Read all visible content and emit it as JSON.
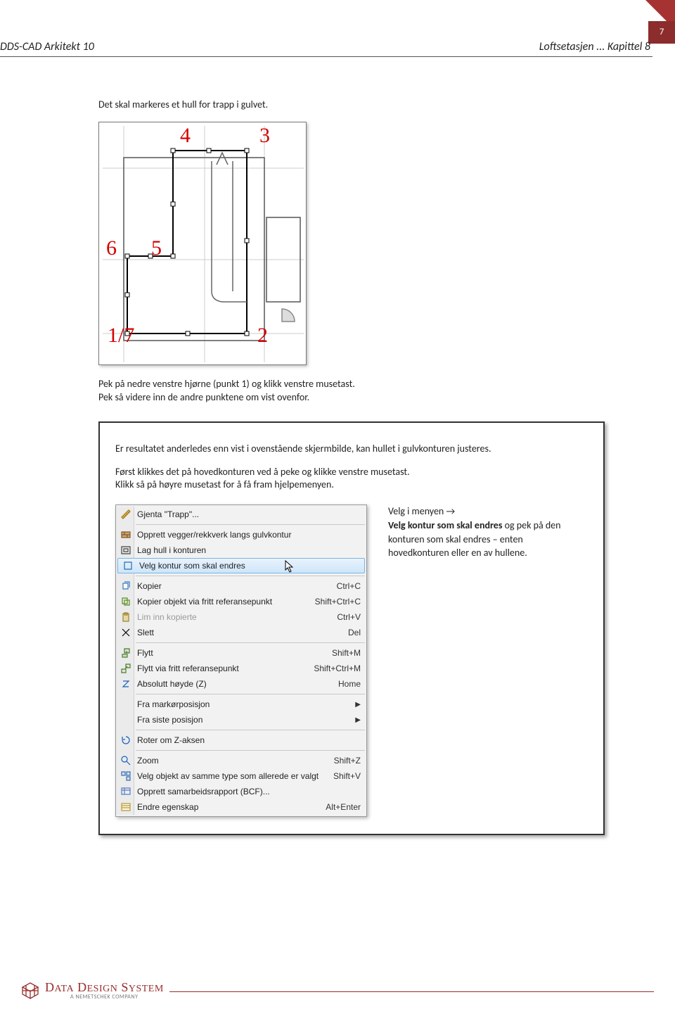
{
  "page": {
    "number": "7"
  },
  "header": {
    "left": "DDS-CAD Arkitekt 10",
    "right": "Loftsetasjen ... Kapittel 8"
  },
  "intro": "Det skal markeres et hull for trapp i gulvet.",
  "drawing": {
    "labels": {
      "n3": "3",
      "n4": "4",
      "n5": "5",
      "n6": "6",
      "n2": "2",
      "n17": "1/7"
    }
  },
  "after1": "Pek på nedre venstre hjørne (punkt 1) og klikk venstre musetast.",
  "after2": "Pek så videre inn de andre punktene om vist ovenfor.",
  "box": {
    "p1": "Er resultatet anderledes enn vist i ovenstående skjermbilde, kan hullet i gulvkonturen justeres.",
    "p2": "Først klikkes det på hovedkonturen ved å peke og klikke venstre musetast.",
    "p3": "Klikk så på høyre musetast for å få fram hjelpemenyen.",
    "side": {
      "lead": "Velg i menyen →",
      "bold": "Velg kontur som skal endres",
      "rest": "og pek på den konturen som skal endres – enten hovedkonturen eller en av hullene."
    }
  },
  "menu": {
    "items": [
      {
        "label": "Gjenta \"Trapp\"...",
        "shortcut": "",
        "icon": "ruler"
      },
      {
        "label": "Opprett vegger/rekkverk langs gulvkontur",
        "shortcut": "",
        "icon": "wall"
      },
      {
        "label": "Lag hull i konturen",
        "shortcut": "",
        "icon": "hole"
      },
      {
        "label": "Velg kontur som skal endres",
        "shortcut": "",
        "icon": "contour",
        "selected": true
      },
      {
        "label": "Kopier",
        "shortcut": "Ctrl+C",
        "icon": "copy"
      },
      {
        "label": "Kopier objekt via fritt referansepunkt",
        "shortcut": "Shift+Ctrl+C",
        "icon": "copyref"
      },
      {
        "label": "Lim inn kopierte",
        "shortcut": "Ctrl+V",
        "icon": "paste",
        "disabled": true
      },
      {
        "label": "Slett",
        "shortcut": "Del",
        "icon": "delete"
      },
      {
        "label": "Flytt",
        "shortcut": "Shift+M",
        "icon": "move"
      },
      {
        "label": "Flytt via fritt referansepunkt",
        "shortcut": "Shift+Ctrl+M",
        "icon": "moveref"
      },
      {
        "label": "Absolutt høyde (Z)",
        "shortcut": "Home",
        "icon": "z"
      },
      {
        "label": "Fra markørposisjon",
        "shortcut": "",
        "icon": "",
        "submenu": true
      },
      {
        "label": "Fra siste posisjon",
        "shortcut": "",
        "icon": "",
        "submenu": true
      },
      {
        "label": "Roter om Z-aksen",
        "shortcut": "",
        "icon": "rotate"
      },
      {
        "label": "Zoom",
        "shortcut": "Shift+Z",
        "icon": "zoom"
      },
      {
        "label": "Velg objekt av samme type som allerede er valgt",
        "shortcut": "Shift+V",
        "icon": "selectsame"
      },
      {
        "label": "Opprett samarbeidsrapport (BCF)...",
        "shortcut": "",
        "icon": "bcf"
      },
      {
        "label": "Endre egenskap",
        "shortcut": "Alt+Enter",
        "icon": "properties"
      }
    ],
    "separatorsAfter": [
      0,
      3,
      7,
      10,
      12,
      13
    ]
  },
  "footer": {
    "brand_caps": "DATA DESIGN SYSTEM",
    "sub": "A NEMETSCHEK COMPANY"
  }
}
